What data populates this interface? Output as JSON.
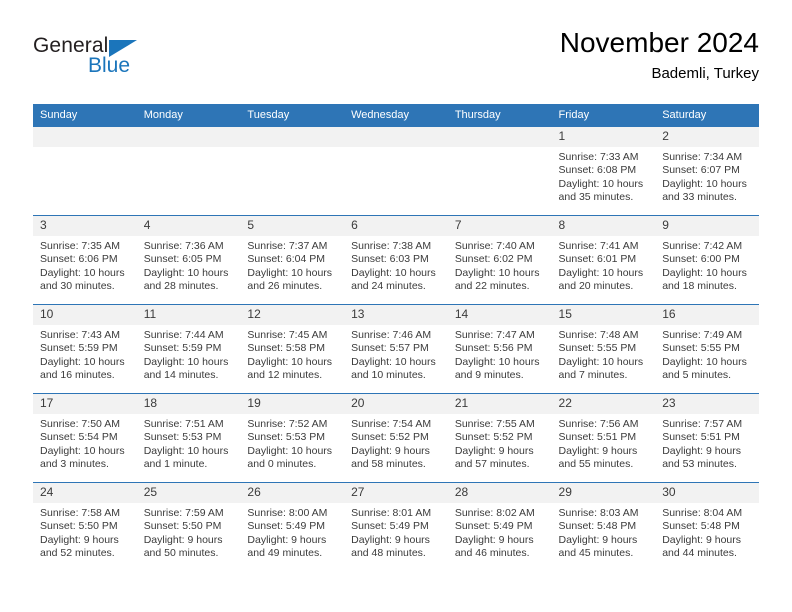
{
  "brand": {
    "name_part1": "General",
    "name_part2": "Blue",
    "logo_icon": "triangle-icon",
    "accent_color": "#1b75bb"
  },
  "header": {
    "title": "November 2024",
    "subtitle": "Bademli, Turkey"
  },
  "theme": {
    "header_bg": "#2e75b6",
    "daynum_bg": "#f2f2f2",
    "text": "#3b3b3b"
  },
  "calendar": {
    "weekday_headers": [
      "Sunday",
      "Monday",
      "Tuesday",
      "Wednesday",
      "Thursday",
      "Friday",
      "Saturday"
    ],
    "weeks": [
      [
        {
          "day": "",
          "empty": true
        },
        {
          "day": "",
          "empty": true
        },
        {
          "day": "",
          "empty": true
        },
        {
          "day": "",
          "empty": true
        },
        {
          "day": "",
          "empty": true
        },
        {
          "day": "1",
          "sunrise": "Sunrise: 7:33 AM",
          "sunset": "Sunset: 6:08 PM",
          "daylight1": "Daylight: 10 hours",
          "daylight2": "and 35 minutes."
        },
        {
          "day": "2",
          "sunrise": "Sunrise: 7:34 AM",
          "sunset": "Sunset: 6:07 PM",
          "daylight1": "Daylight: 10 hours",
          "daylight2": "and 33 minutes."
        }
      ],
      [
        {
          "day": "3",
          "sunrise": "Sunrise: 7:35 AM",
          "sunset": "Sunset: 6:06 PM",
          "daylight1": "Daylight: 10 hours",
          "daylight2": "and 30 minutes."
        },
        {
          "day": "4",
          "sunrise": "Sunrise: 7:36 AM",
          "sunset": "Sunset: 6:05 PM",
          "daylight1": "Daylight: 10 hours",
          "daylight2": "and 28 minutes."
        },
        {
          "day": "5",
          "sunrise": "Sunrise: 7:37 AM",
          "sunset": "Sunset: 6:04 PM",
          "daylight1": "Daylight: 10 hours",
          "daylight2": "and 26 minutes."
        },
        {
          "day": "6",
          "sunrise": "Sunrise: 7:38 AM",
          "sunset": "Sunset: 6:03 PM",
          "daylight1": "Daylight: 10 hours",
          "daylight2": "and 24 minutes."
        },
        {
          "day": "7",
          "sunrise": "Sunrise: 7:40 AM",
          "sunset": "Sunset: 6:02 PM",
          "daylight1": "Daylight: 10 hours",
          "daylight2": "and 22 minutes."
        },
        {
          "day": "8",
          "sunrise": "Sunrise: 7:41 AM",
          "sunset": "Sunset: 6:01 PM",
          "daylight1": "Daylight: 10 hours",
          "daylight2": "and 20 minutes."
        },
        {
          "day": "9",
          "sunrise": "Sunrise: 7:42 AM",
          "sunset": "Sunset: 6:00 PM",
          "daylight1": "Daylight: 10 hours",
          "daylight2": "and 18 minutes."
        }
      ],
      [
        {
          "day": "10",
          "sunrise": "Sunrise: 7:43 AM",
          "sunset": "Sunset: 5:59 PM",
          "daylight1": "Daylight: 10 hours",
          "daylight2": "and 16 minutes."
        },
        {
          "day": "11",
          "sunrise": "Sunrise: 7:44 AM",
          "sunset": "Sunset: 5:59 PM",
          "daylight1": "Daylight: 10 hours",
          "daylight2": "and 14 minutes."
        },
        {
          "day": "12",
          "sunrise": "Sunrise: 7:45 AM",
          "sunset": "Sunset: 5:58 PM",
          "daylight1": "Daylight: 10 hours",
          "daylight2": "and 12 minutes."
        },
        {
          "day": "13",
          "sunrise": "Sunrise: 7:46 AM",
          "sunset": "Sunset: 5:57 PM",
          "daylight1": "Daylight: 10 hours",
          "daylight2": "and 10 minutes."
        },
        {
          "day": "14",
          "sunrise": "Sunrise: 7:47 AM",
          "sunset": "Sunset: 5:56 PM",
          "daylight1": "Daylight: 10 hours",
          "daylight2": "and 9 minutes."
        },
        {
          "day": "15",
          "sunrise": "Sunrise: 7:48 AM",
          "sunset": "Sunset: 5:55 PM",
          "daylight1": "Daylight: 10 hours",
          "daylight2": "and 7 minutes."
        },
        {
          "day": "16",
          "sunrise": "Sunrise: 7:49 AM",
          "sunset": "Sunset: 5:55 PM",
          "daylight1": "Daylight: 10 hours",
          "daylight2": "and 5 minutes."
        }
      ],
      [
        {
          "day": "17",
          "sunrise": "Sunrise: 7:50 AM",
          "sunset": "Sunset: 5:54 PM",
          "daylight1": "Daylight: 10 hours",
          "daylight2": "and 3 minutes."
        },
        {
          "day": "18",
          "sunrise": "Sunrise: 7:51 AM",
          "sunset": "Sunset: 5:53 PM",
          "daylight1": "Daylight: 10 hours",
          "daylight2": "and 1 minute."
        },
        {
          "day": "19",
          "sunrise": "Sunrise: 7:52 AM",
          "sunset": "Sunset: 5:53 PM",
          "daylight1": "Daylight: 10 hours",
          "daylight2": "and 0 minutes."
        },
        {
          "day": "20",
          "sunrise": "Sunrise: 7:54 AM",
          "sunset": "Sunset: 5:52 PM",
          "daylight1": "Daylight: 9 hours",
          "daylight2": "and 58 minutes."
        },
        {
          "day": "21",
          "sunrise": "Sunrise: 7:55 AM",
          "sunset": "Sunset: 5:52 PM",
          "daylight1": "Daylight: 9 hours",
          "daylight2": "and 57 minutes."
        },
        {
          "day": "22",
          "sunrise": "Sunrise: 7:56 AM",
          "sunset": "Sunset: 5:51 PM",
          "daylight1": "Daylight: 9 hours",
          "daylight2": "and 55 minutes."
        },
        {
          "day": "23",
          "sunrise": "Sunrise: 7:57 AM",
          "sunset": "Sunset: 5:51 PM",
          "daylight1": "Daylight: 9 hours",
          "daylight2": "and 53 minutes."
        }
      ],
      [
        {
          "day": "24",
          "sunrise": "Sunrise: 7:58 AM",
          "sunset": "Sunset: 5:50 PM",
          "daylight1": "Daylight: 9 hours",
          "daylight2": "and 52 minutes."
        },
        {
          "day": "25",
          "sunrise": "Sunrise: 7:59 AM",
          "sunset": "Sunset: 5:50 PM",
          "daylight1": "Daylight: 9 hours",
          "daylight2": "and 50 minutes."
        },
        {
          "day": "26",
          "sunrise": "Sunrise: 8:00 AM",
          "sunset": "Sunset: 5:49 PM",
          "daylight1": "Daylight: 9 hours",
          "daylight2": "and 49 minutes."
        },
        {
          "day": "27",
          "sunrise": "Sunrise: 8:01 AM",
          "sunset": "Sunset: 5:49 PM",
          "daylight1": "Daylight: 9 hours",
          "daylight2": "and 48 minutes."
        },
        {
          "day": "28",
          "sunrise": "Sunrise: 8:02 AM",
          "sunset": "Sunset: 5:49 PM",
          "daylight1": "Daylight: 9 hours",
          "daylight2": "and 46 minutes."
        },
        {
          "day": "29",
          "sunrise": "Sunrise: 8:03 AM",
          "sunset": "Sunset: 5:48 PM",
          "daylight1": "Daylight: 9 hours",
          "daylight2": "and 45 minutes."
        },
        {
          "day": "30",
          "sunrise": "Sunrise: 8:04 AM",
          "sunset": "Sunset: 5:48 PM",
          "daylight1": "Daylight: 9 hours",
          "daylight2": "and 44 minutes."
        }
      ]
    ]
  }
}
